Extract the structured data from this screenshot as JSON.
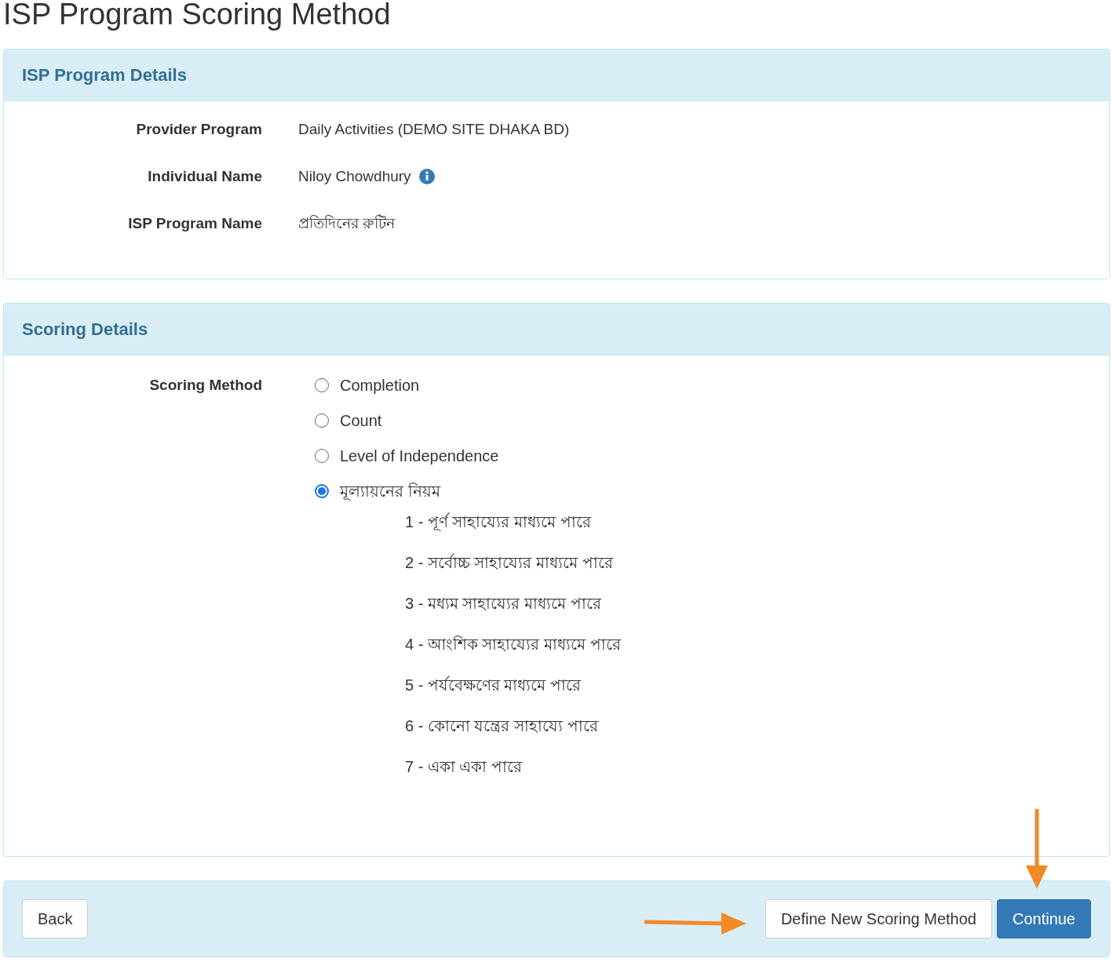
{
  "page_title": "ISP Program Scoring Method",
  "program_details": {
    "heading": "ISP Program Details",
    "fields": [
      {
        "label": "Provider Program",
        "value": "Daily Activities (DEMO SITE DHAKA BD)",
        "info": false
      },
      {
        "label": "Individual Name",
        "value": "Niloy Chowdhury",
        "info": true
      },
      {
        "label": "ISP Program Name",
        "value": "প্রতিদিনের রুটিন",
        "info": false
      }
    ]
  },
  "scoring_details": {
    "heading": "Scoring Details",
    "label": "Scoring Method",
    "options": [
      {
        "label": "Completion",
        "selected": false
      },
      {
        "label": "Count",
        "selected": false
      },
      {
        "label": "Level of Independence",
        "selected": false
      },
      {
        "label": "মূল্যায়নের নিয়ম",
        "selected": true
      }
    ],
    "levels": [
      "1 - পূর্ণ সাহায্যের মাধ্যমে পারে",
      "2 - সর্বোচ্চ সাহায্যের মাধ্যমে পারে",
      "3 - মধ্যম সাহায্যের মাধ্যমে পারে",
      "4 - আংশিক সাহায্যের মাধ্যমে পারে",
      "5 - পর্যবেক্ষণের মাধ্যমে পারে",
      "6 - কোনো যন্ত্রের সাহায্যে পারে",
      "7 - একা একা পারে"
    ]
  },
  "footer": {
    "back": "Back",
    "define": "Define New Scoring Method",
    "continue": "Continue"
  }
}
